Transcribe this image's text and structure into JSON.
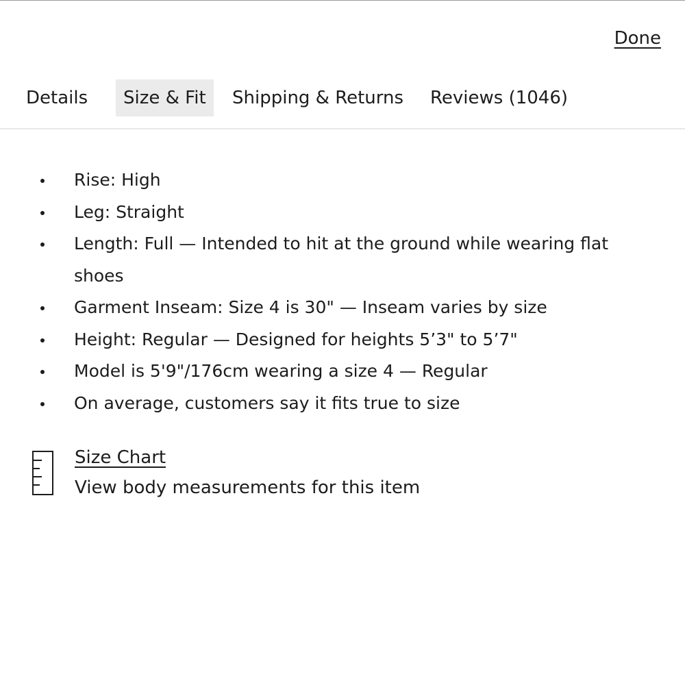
{
  "header": {
    "done_label": "Done"
  },
  "tabs": [
    {
      "label": "Details",
      "active": false
    },
    {
      "label": "Size & Fit",
      "active": true
    },
    {
      "label": "Shipping & Returns",
      "active": false
    },
    {
      "label": "Reviews (1046)",
      "active": false
    }
  ],
  "fit_details": [
    "Rise: High",
    "Leg: Straight",
    "Length: Full — Intended to hit at the ground while wearing flat shoes",
    "Garment Inseam: Size 4 is 30\" — Inseam varies by size",
    "Height: Regular — Designed for heights 5’3\" to 5’7\"",
    "Model is 5'9\"/176cm wearing a size 4  —  Regular",
    "On average, customers say it fits true to size"
  ],
  "size_chart": {
    "icon": "ruler-icon",
    "link_label": "Size Chart",
    "description": "View body measurements for this item"
  }
}
